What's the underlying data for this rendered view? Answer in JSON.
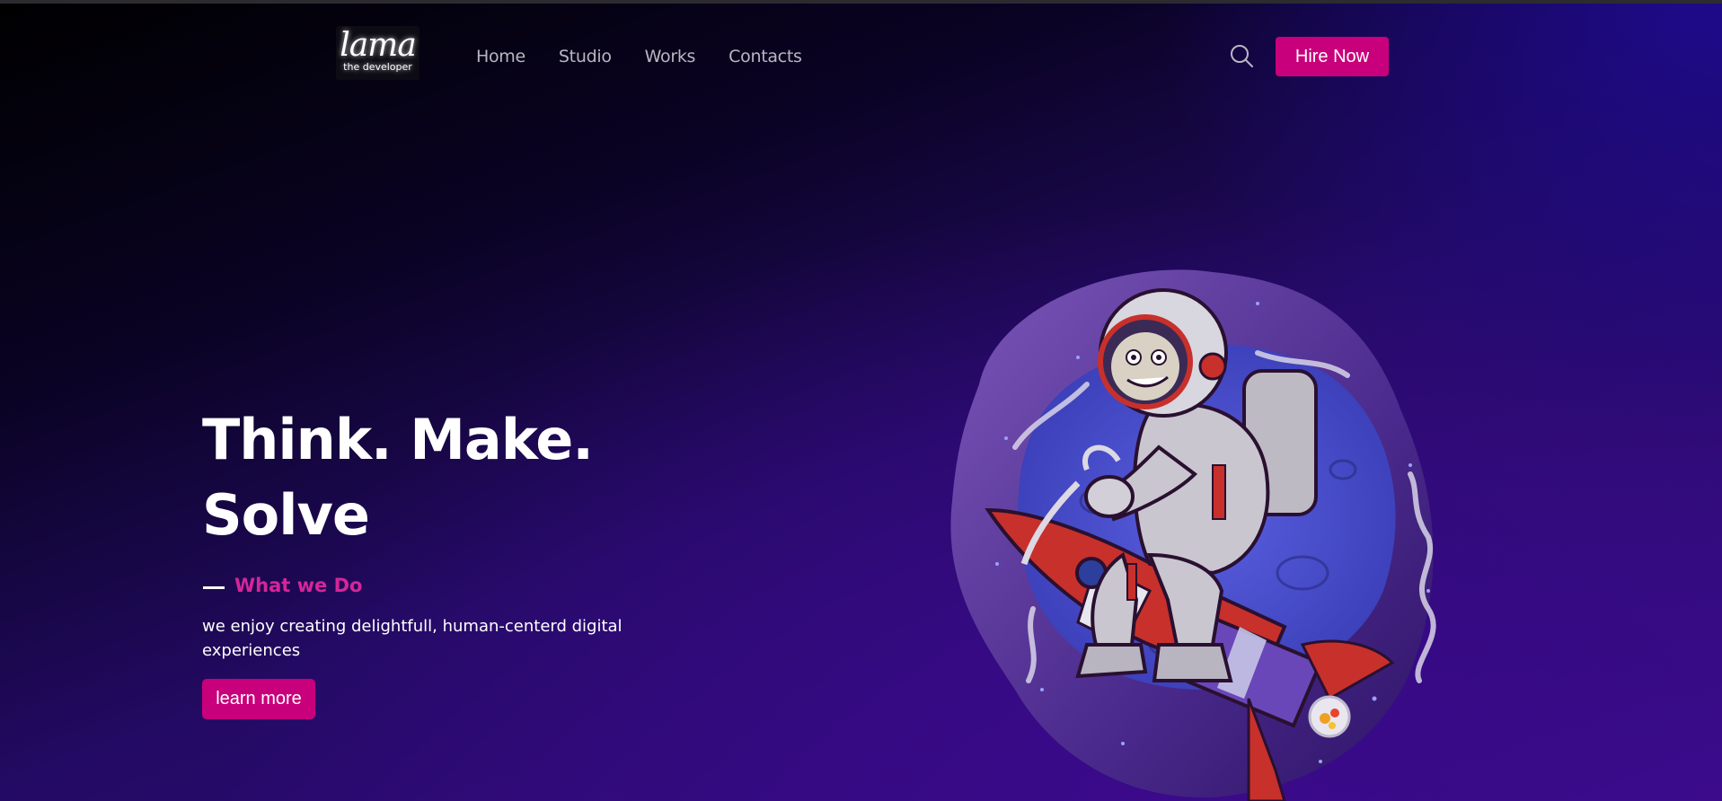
{
  "navbar": {
    "logo": {
      "main": "lama",
      "sub": "the developer"
    },
    "links": [
      "Home",
      "Studio",
      "Works",
      "Contacts"
    ],
    "search_icon": "search-icon",
    "cta_label": "Hire Now"
  },
  "hero": {
    "title": "Think. Make. Solve",
    "section_label": "What we Do",
    "description": "we enjoy creating delightfull, human-centerd digital experiences",
    "button_label": "learn more",
    "illustration": "astronaut-riding-rocket"
  },
  "colors": {
    "accent": "#c8007b",
    "section_label": "#d6259a",
    "background_dark": "#000000",
    "background_purple": "#3b0c8c",
    "blob": "#6b4bb0"
  }
}
